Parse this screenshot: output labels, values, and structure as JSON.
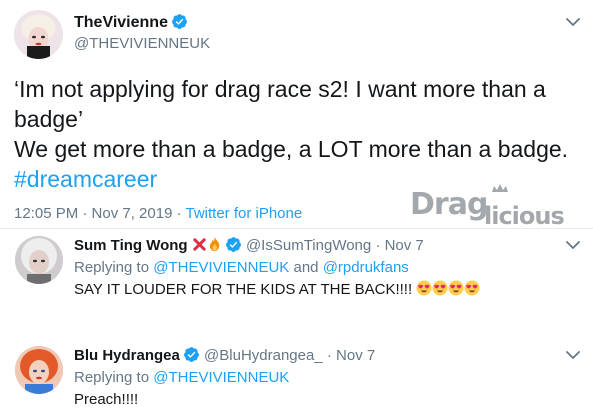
{
  "main_tweet": {
    "display_name": "TheVivienne",
    "handle": "@THEVIVIENNEUK",
    "lines": [
      "‘Im not applying for drag race s2! I want more than a",
      "badge’",
      "We get more than a badge, a LOT more than a badge."
    ],
    "hashtag": "#dreamcareer",
    "time": "12:05 PM · Nov 7, 2019 · ",
    "source": "Twitter for iPhone"
  },
  "watermark": {
    "brand": "Draglicious"
  },
  "replies": [
    {
      "display_name": "Sum Ting Wong",
      "name_emojis": [
        "cross-mark-emoji",
        "fire-emoji"
      ],
      "handle": "@IsSumTingWong",
      "date": "Nov 7",
      "replying_prefix": "Replying to ",
      "mentions": [
        "@THEVIVIENNEUK",
        "@rpdrukfans"
      ],
      "mention_joiner": " and ",
      "text": "SAY IT LOUDER FOR THE KIDS AT THE BACK!!!!",
      "trailing_emojis": [
        "heart-eyes-emoji",
        "heart-eyes-emoji",
        "heart-eyes-emoji",
        "heart-eyes-emoji"
      ]
    },
    {
      "display_name": "Blu Hydrangea",
      "handle": "@BluHydrangea_",
      "date": "Nov 7",
      "replying_prefix": "Replying to ",
      "mentions": [
        "@THEVIVIENNEUK"
      ],
      "text": "Preach!!!!"
    }
  ],
  "colors": {
    "link": "#1da1f2",
    "secondary_text": "#657786",
    "primary_text": "#14171a",
    "divider": "#e6ecf0",
    "watermark": "#9aa0a6"
  },
  "icons": {
    "verified": "verified-badge-icon",
    "more": "chevron-down-icon"
  }
}
